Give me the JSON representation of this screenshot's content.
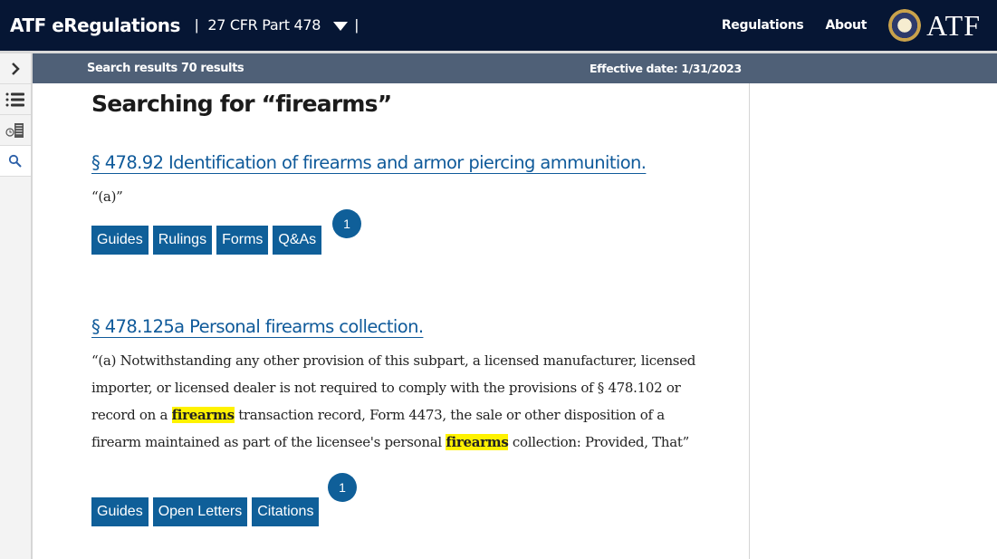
{
  "header": {
    "brand": "ATF eRegulations",
    "separator": "|",
    "part_selector": "27 CFR Part 478",
    "nav": [
      "Regulations",
      "About"
    ],
    "logo_text": "ATF"
  },
  "rail": {
    "icons": [
      "chevron-right-icon",
      "table-of-contents-icon",
      "timeline-icon",
      "search-icon"
    ]
  },
  "subbar": {
    "results_label": "Search results 70 results",
    "effective_date": "Effective date: 1/31/2023"
  },
  "search": {
    "title": "Searching for “firearms”"
  },
  "results": [
    {
      "title": "§ 478.92 Identification of firearms and armor piercing ammunition.",
      "snippet": "“(a)”",
      "tags": [
        "Guides",
        "Rulings",
        "Forms",
        "Q&As"
      ],
      "badge": "1"
    },
    {
      "title": "§ 478.125a Personal firearms collection.",
      "snippet_parts": [
        "“(a) Notwithstanding any other provision of this subpart, a licensed manufacturer, licensed importer, or licensed dealer is not required to comply with the provisions of § 478.102 or record on a ",
        "firearms",
        " transaction record, Form 4473, the sale or other disposition of a firearm maintained as part of the licensee's personal ",
        "firearms",
        " collection: Provided, That”"
      ],
      "tags": [
        "Guides",
        "Open Letters",
        "Citations"
      ],
      "badge": "1"
    }
  ],
  "colors": {
    "header_bg": "#061634",
    "subbar_bg": "#4f6077",
    "link": "#0f5a9a",
    "tag_bg": "#0f5f99",
    "highlight": "#fff200"
  }
}
